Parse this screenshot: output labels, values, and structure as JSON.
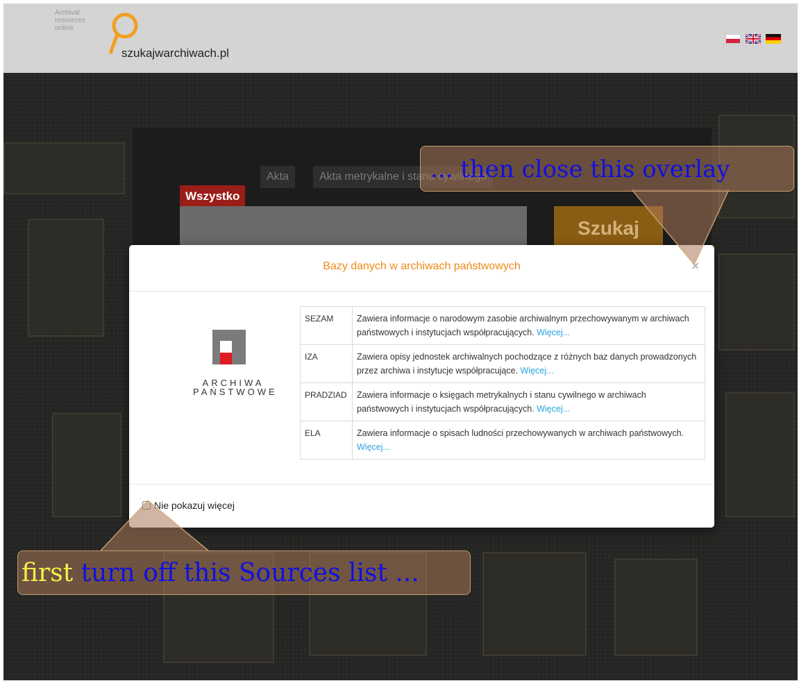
{
  "header": {
    "small_logo_lines": [
      "Archival",
      "resources",
      "online"
    ],
    "site_name": "szukajwarchiwach.pl",
    "flags": [
      "pl-flag",
      "uk-flag",
      "de-flag"
    ]
  },
  "search": {
    "tabs": [
      "Akta",
      "Akta metrykalne i stanu cywilnego"
    ],
    "active_tab": "Wszystko",
    "input_value": "",
    "button_label": "Szukaj"
  },
  "modal": {
    "title": "Bazy danych w archiwach państwowych",
    "close_label": "×",
    "logo_lines": [
      "ARCHIWA",
      "PAŃSTWOWE"
    ],
    "rows": [
      {
        "name": "SEZAM",
        "desc": "Zawiera informacje o narodowym zasobie archiwalnym przechowywanym w archiwach państwowych i instytucjach współpracujących.",
        "link": "Więcej..."
      },
      {
        "name": "IZA",
        "desc": "Zawiera opisy jednostek archiwalnych pochodzące z różnych baz danych prowadzonych przez archiwa i instytucje współpracujące.",
        "link": "Więcej..."
      },
      {
        "name": "PRADZIAD",
        "desc": "Zawiera informacje o księgach metrykalnych i stanu cywilnego w archiwach państwowych i instytucjach współpracujących.",
        "link": "Więcej..."
      },
      {
        "name": "ELA",
        "desc": "Zawiera informacje o spisach ludności przechowywanych w archiwach państwowych.",
        "link": "Więcej..."
      }
    ],
    "footer_checkbox_label": "Nie pokazuj więcej"
  },
  "annotations": {
    "top": "... then close this overlay",
    "bottom_first": "first",
    "bottom_rest": " turn off this Sources list ..."
  },
  "colors": {
    "accent_orange": "#ef8a17",
    "active_tab_red": "#9a1d17",
    "link_blue": "#2aa3e0",
    "callout_text_blue": "#1010e0",
    "callout_highlight_yellow": "#f4f04a"
  }
}
